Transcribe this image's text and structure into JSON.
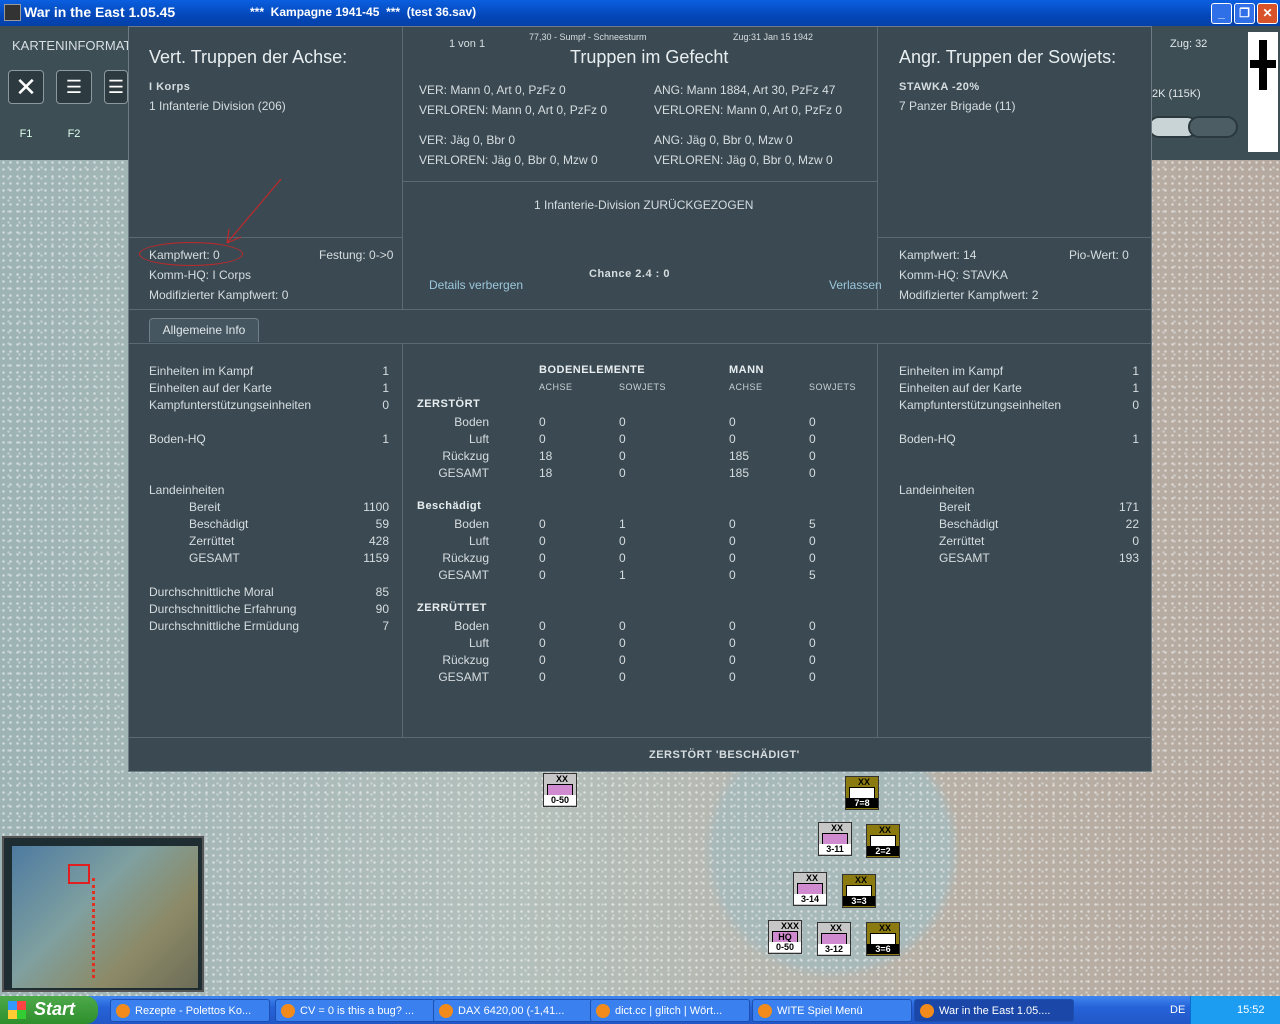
{
  "window": {
    "title": "War in the East 1.05.45",
    "subtitle": "***  Kampagne 1941-45  ***  (test 36.sav)"
  },
  "topbar": {
    "label": "KARTENINFORMAT",
    "zug": "Zug: 32",
    "mann": "2K (115K)",
    "f1": "F1",
    "f2": "F2"
  },
  "dialog": {
    "left_title": "Vert. Truppen der Achse:",
    "left_unit_hdr": "I Korps",
    "left_unit": "1 Infanterie Division (206)",
    "center_top_page": "1 von 1",
    "center_top_info": "77,30 - Sumpf - Schneesturm",
    "center_top_zug": "Zug:31  Jan 15 1942",
    "center_title": "Truppen im Gefecht",
    "ver1": "VER: Mann 0, Art 0, PzFz 0",
    "verl1": "VERLOREN: Mann 0, Art 0, PzFz 0",
    "ver2": "VER: Jäg 0, Bbr 0",
    "verl2": "VERLOREN: Jäg 0, Bbr 0, Mzw 0",
    "ang1": "ANG: Mann 1884, Art 30, PzFz 47",
    "angl1": "VERLOREN: Mann 0, Art 0, PzFz 0",
    "ang2": "ANG: Jäg 0, Bbr 0, Mzw 0",
    "angl2": "VERLOREN: Jäg 0, Bbr 0, Mzw 0",
    "retreat_msg": "1 Infanterie-Division ZURÜCKGEZOGEN",
    "chance": "Chance 2.4 : 0",
    "details_link": "Details verbergen",
    "leave_link": "Verlassen",
    "right_title": "Angr. Truppen der Sowjets:",
    "right_unit_hdr": "STAWKA   -20%",
    "right_unit": "7 Panzer Brigade (11)",
    "left_kampfwert": "Kampfwert: 0",
    "left_festung": "Festung: 0->0",
    "left_hq": "Komm-HQ: I Corps",
    "left_mod": "Modifizierter Kampfwert: 0",
    "right_kampfwert": "Kampfwert: 14",
    "right_pio": "Pio-Wert: 0",
    "right_hq": "Komm-HQ: STAVKA",
    "right_mod": "Modifizierter Kampfwert: 2",
    "tab": "Allgemeine Info",
    "footer": "ZERSTÖRT 'BESCHÄDIGT'"
  },
  "left_stats": [
    {
      "label": "Einheiten im Kampf",
      "value": "1"
    },
    {
      "label": "Einheiten auf der Karte",
      "value": "1"
    },
    {
      "label": "Kampfunterstützungseinheiten",
      "value": "0"
    },
    {
      "label": "Boden-HQ",
      "value": "1"
    },
    {
      "label": "Landeinheiten",
      "value": ""
    },
    {
      "label": "Bereit",
      "value": "1100"
    },
    {
      "label": "Beschädigt",
      "value": "59"
    },
    {
      "label": "Zerrüttet",
      "value": "428"
    },
    {
      "label": "GESAMT",
      "value": "1159"
    },
    {
      "label": "Durchschnittliche Moral",
      "value": "85"
    },
    {
      "label": "Durchschnittliche Erfahrung",
      "value": "90"
    },
    {
      "label": "Durchschnittliche Ermüdung",
      "value": "7"
    }
  ],
  "right_stats": [
    {
      "label": "Einheiten im Kampf",
      "value": "1"
    },
    {
      "label": "Einheiten auf der Karte",
      "value": "1"
    },
    {
      "label": "Kampfunterstützungseinheiten",
      "value": "0"
    },
    {
      "label": "Boden-HQ",
      "value": "1"
    },
    {
      "label": "Landeinheiten",
      "value": ""
    },
    {
      "label": "Bereit",
      "value": "171"
    },
    {
      "label": "Beschädigt",
      "value": "22"
    },
    {
      "label": "Zerrüttet",
      "value": "0"
    },
    {
      "label": "GESAMT",
      "value": "193"
    }
  ],
  "table": {
    "hdr_boden": "BODENELEMENTE",
    "hdr_mann": "MANN",
    "achse": "ACHSE",
    "sowjets": "SOWJETS",
    "groups": [
      {
        "name": "ZERSTÖRT",
        "rows": [
          [
            "Boden",
            "0",
            "0",
            "0",
            "0"
          ],
          [
            "Luft",
            "0",
            "0",
            "0",
            "0"
          ],
          [
            "Rückzug",
            "18",
            "0",
            "185",
            "0"
          ],
          [
            "GESAMT",
            "18",
            "0",
            "185",
            "0"
          ]
        ]
      },
      {
        "name": "Beschädigt",
        "rows": [
          [
            "Boden",
            "0",
            "1",
            "0",
            "5"
          ],
          [
            "Luft",
            "0",
            "0",
            "0",
            "0"
          ],
          [
            "Rückzug",
            "0",
            "0",
            "0",
            "0"
          ],
          [
            "GESAMT",
            "0",
            "1",
            "0",
            "5"
          ]
        ]
      },
      {
        "name": "ZERRÜTTET",
        "rows": [
          [
            "Boden",
            "0",
            "0",
            "0",
            "0"
          ],
          [
            "Luft",
            "0",
            "0",
            "0",
            "0"
          ],
          [
            "Rückzug",
            "0",
            "0",
            "0",
            "0"
          ],
          [
            "GESAMT",
            "0",
            "0",
            "0",
            "0"
          ]
        ]
      }
    ]
  },
  "units": [
    {
      "val": "0-50",
      "size": "XX"
    },
    {
      "val": "7=8",
      "size": "XX"
    },
    {
      "val": "3-11",
      "size": "XX"
    },
    {
      "val": "2=2",
      "size": "XX"
    },
    {
      "val": "3-14",
      "size": "XX"
    },
    {
      "val": "3=3",
      "size": "XX"
    },
    {
      "val": "0-50",
      "size": "XXX",
      "hq": "HQ"
    },
    {
      "val": "3-12",
      "size": "XX"
    },
    {
      "val": "3=6",
      "size": "XX"
    }
  ],
  "taskbar": {
    "start": "Start",
    "tasks": [
      "Rezepte - Polettos Ko...",
      "CV = 0 is this a bug? ...",
      "DAX 6420,00 (-1,41...",
      "dict.cc | glitch | Wört...",
      "WITE  Spiel Menü",
      "War in the East 1.05...."
    ],
    "lang": "DE",
    "clock": "15:52"
  }
}
